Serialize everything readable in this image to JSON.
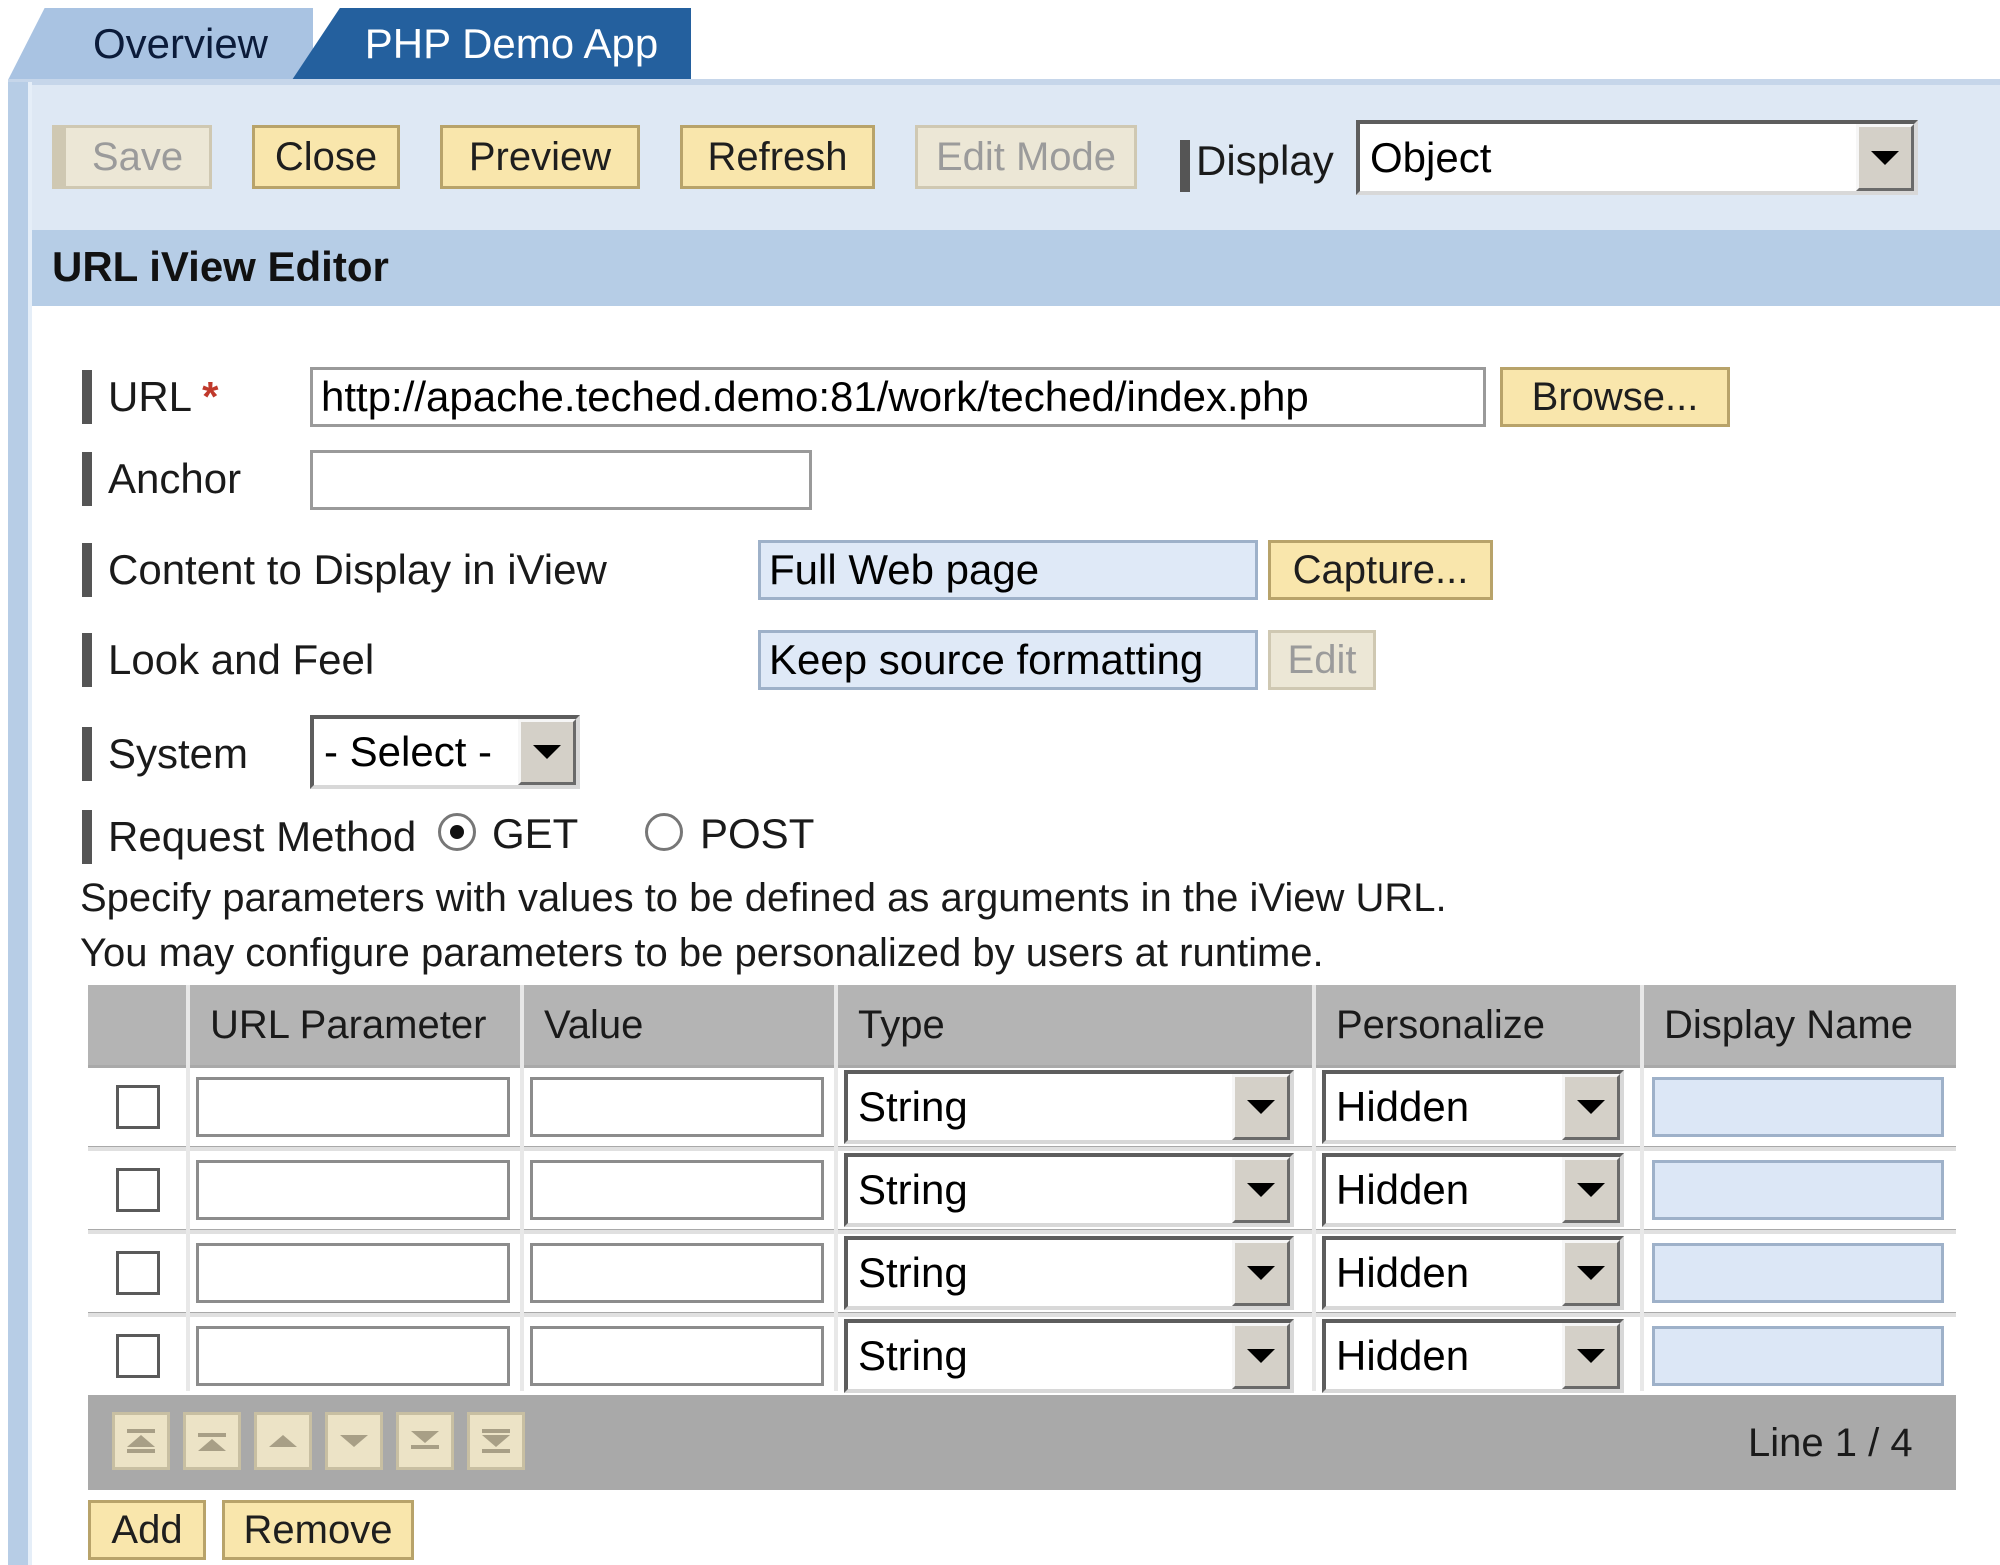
{
  "tabs": [
    {
      "label": "Overview"
    },
    {
      "label": "PHP Demo App"
    }
  ],
  "toolbar": {
    "save_label": "Save",
    "close_label": "Close",
    "preview_label": "Preview",
    "refresh_label": "Refresh",
    "editmode_label": "Edit Mode",
    "display_label": "Display",
    "display_value": "Object"
  },
  "section": {
    "title": "URL iView Editor"
  },
  "form": {
    "url_label": "URL",
    "required_marker": "*",
    "url_value": "http://apache.teched.demo:81/work/teched/index.php",
    "browse_label": "Browse...",
    "anchor_label": "Anchor",
    "anchor_value": "",
    "content_label": "Content to Display in iView",
    "content_value": "Full Web page",
    "capture_label": "Capture...",
    "look_label": "Look and Feel",
    "look_value": "Keep source formatting",
    "edit_label": "Edit",
    "system_label": "System",
    "system_value": "- Select -",
    "request_label": "Request Method",
    "method_get": "GET",
    "method_post": "POST",
    "selected_method": "GET"
  },
  "info": {
    "line1": "Specify parameters with values to be defined as arguments in the iView URL.",
    "line2": "You may configure parameters to be personalized by users at runtime."
  },
  "table": {
    "headers": [
      "URL Parameter",
      "Value",
      "Type",
      "Personalize",
      "Display Name"
    ],
    "rows": [
      {
        "type": "String",
        "personalize": "Hidden"
      },
      {
        "type": "String",
        "personalize": "Hidden"
      },
      {
        "type": "String",
        "personalize": "Hidden"
      },
      {
        "type": "String",
        "personalize": "Hidden"
      }
    ],
    "line_count": "Line 1 / 4"
  },
  "bottom": {
    "add_label": "Add",
    "remove_label": "Remove"
  },
  "colors": {
    "button_bg": "#f9e6ac",
    "header_band": "#b6cde6",
    "active_tab": "#24609e"
  }
}
